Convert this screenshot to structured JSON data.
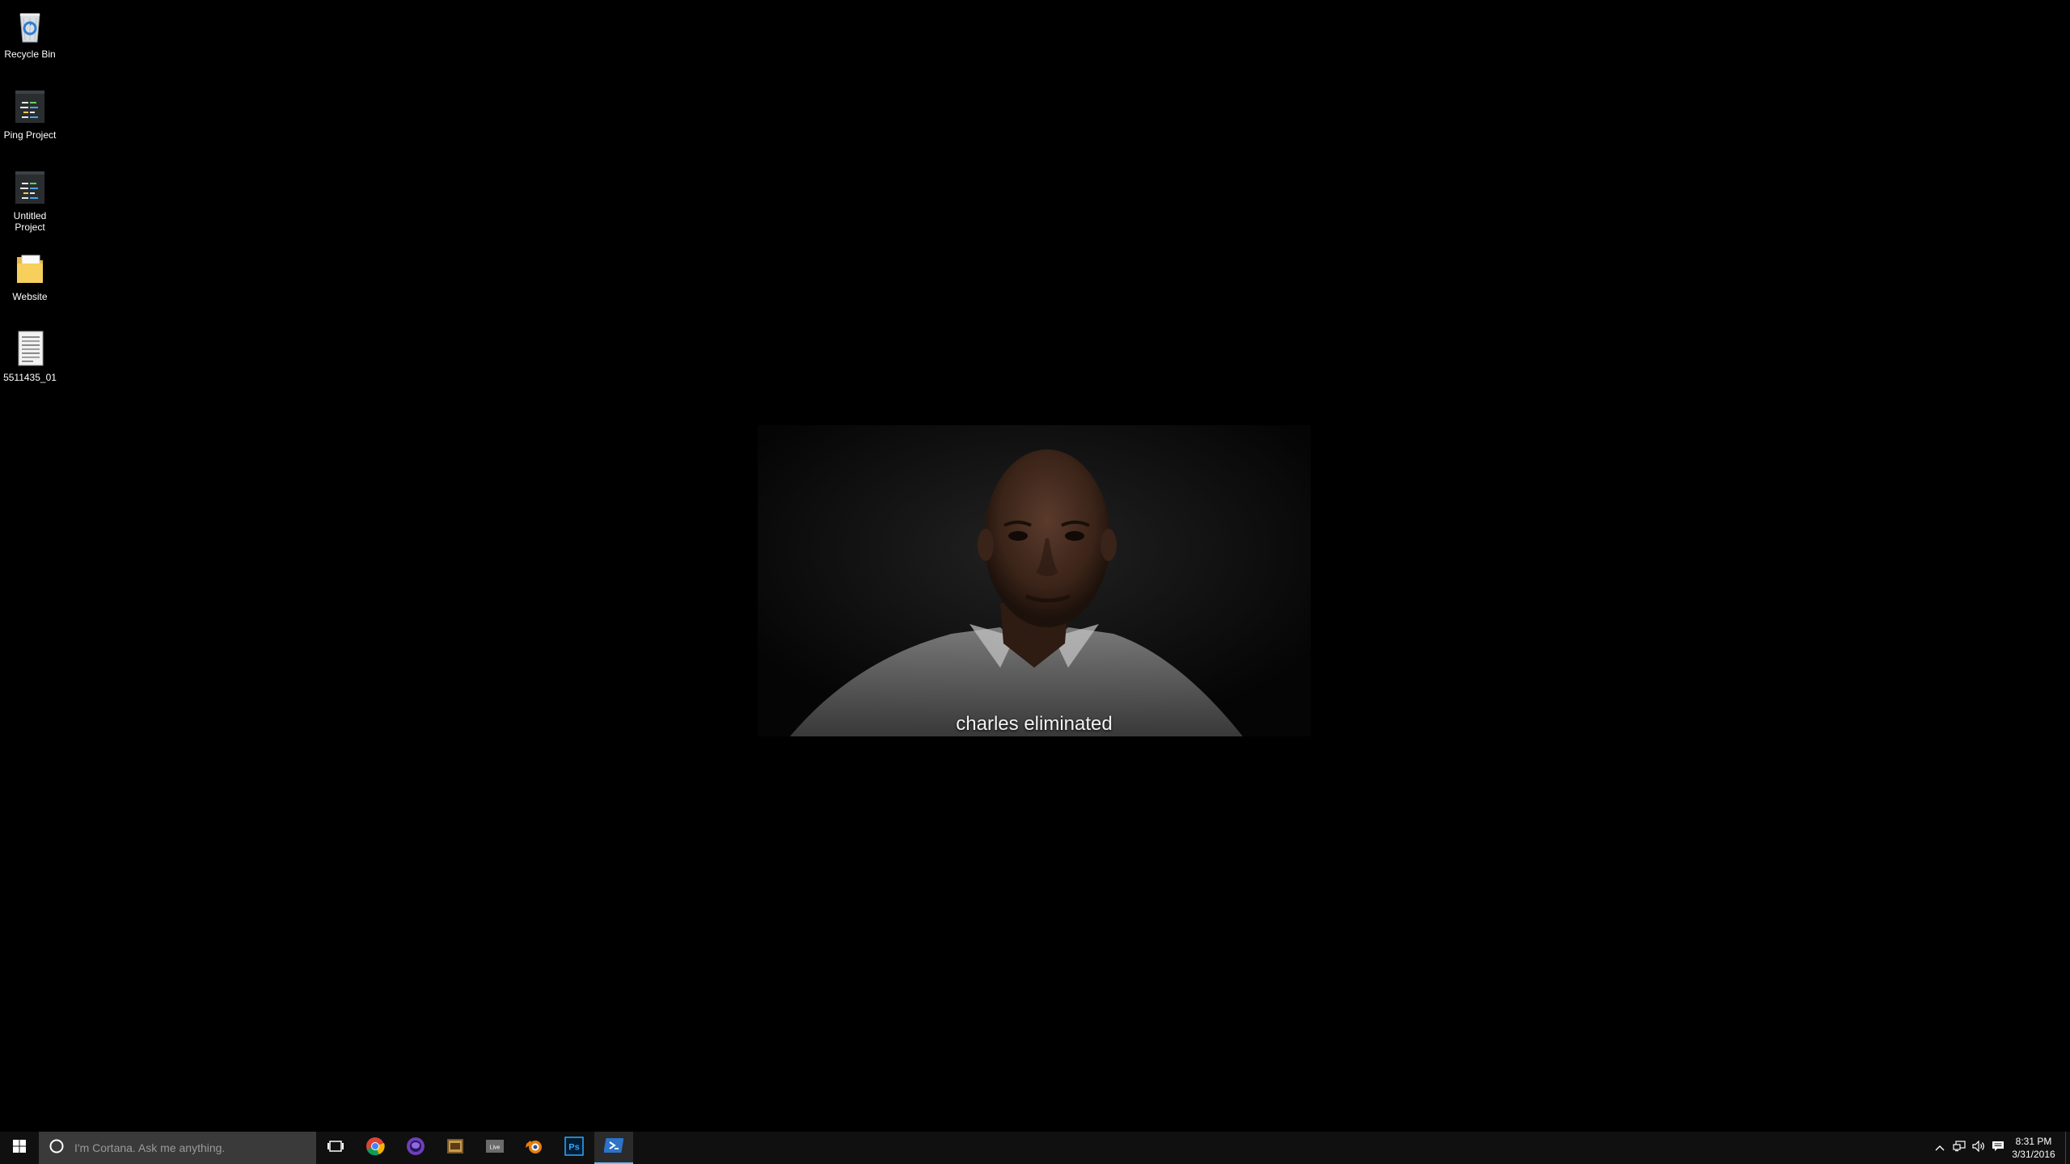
{
  "desktop": {
    "icons": [
      {
        "label": "Recycle Bin",
        "icon": "recycle-bin-icon"
      },
      {
        "label": "Ping Project",
        "icon": "project-file-icon"
      },
      {
        "label": "Untitled Project",
        "icon": "project-file-icon"
      },
      {
        "label": "Website",
        "icon": "folder-icon"
      },
      {
        "label": "5511435_01",
        "icon": "document-icon"
      }
    ]
  },
  "video": {
    "subtitle": "charles eliminated"
  },
  "taskbar": {
    "search_placeholder": "I'm Cortana. Ask me anything.",
    "pinned": [
      {
        "name": "task-view-icon"
      },
      {
        "name": "chrome-icon"
      },
      {
        "name": "browser-purple-icon"
      },
      {
        "name": "file-app-icon"
      },
      {
        "name": "live-app-icon"
      },
      {
        "name": "blender-icon"
      },
      {
        "name": "photoshop-icon",
        "text": "Ps"
      },
      {
        "name": "powershell-icon"
      }
    ],
    "clock": {
      "time": "8:31 PM",
      "date": "3/31/2016"
    },
    "accent_color": "#76b9ed"
  }
}
